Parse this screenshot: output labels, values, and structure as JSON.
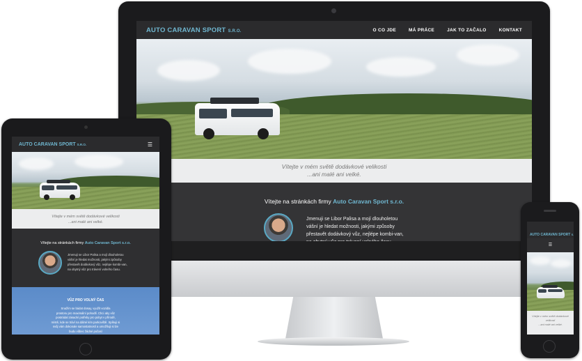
{
  "site": {
    "logo_text": "AUTO CARAVAN SPORT",
    "logo_suffix": "S.R.O."
  },
  "nav": {
    "items": [
      {
        "label": "O CO JDE"
      },
      {
        "label": "MÁ PRÁCE"
      },
      {
        "label": "JAK TO ZAČALO"
      },
      {
        "label": "KONTAKT"
      }
    ],
    "menu_icon": "hamburger-icon",
    "menu_glyph": "☰"
  },
  "tagline": {
    "line1": "Vítejte v mém světě dodávkové velikosti",
    "line2": "...ani malé ani velké.",
    "phone_line1": "Vítejte v mém světě dodávkové",
    "phone_line2": "velikosti",
    "phone_line3": "...ani malé ani velké."
  },
  "welcome": {
    "prefix": "Vítejte na stránkách firmy",
    "company": "Auto Caravan Sport s.r.o.",
    "desktop_lines": [
      "Jmenuji se Libor Palisa a mojí dlouholetou",
      "vášní je hledat možnosti, jakými způsoby",
      "přestavět dodávkový vůz, nejlépe kombi-van,",
      "na obytný vůz pro trávení volného času."
    ],
    "tablet_lines": [
      "Jmenuji se Libor Palisa a mojí dlouholetou",
      "vášní je hledat možnosti, jakými způsoby",
      "přestavět dodávkový vůz, nejlépe kombi-van,",
      "na obytný vůz pro trávení volného času."
    ]
  },
  "section_free_time": {
    "title": "VŮZ PRO VOLNÝ ČAS",
    "lines": [
      "Snažím se bádat dosay, využít vozidla",
      "prostoru pro maximální pohodlí. Chci aby vůz",
      "postrádal zásadní potřeby pro pobyt v přírodě,",
      "místě, kde se tráví na dálné kím parkoviště. Spíkuji si",
      "svůj vám dokonale samostatností a umožňuji si lze",
      "budu vůbec žádné počasí"
    ]
  },
  "colors": {
    "accent": "#6fb6cf",
    "dark_bg": "#2f2f31",
    "band_bg": "#ecedee",
    "blue_section": "#5b8bc9"
  },
  "icons": {
    "camera": "camera-icon",
    "home_button": "home-button-icon",
    "avatar": "profile-photo"
  }
}
